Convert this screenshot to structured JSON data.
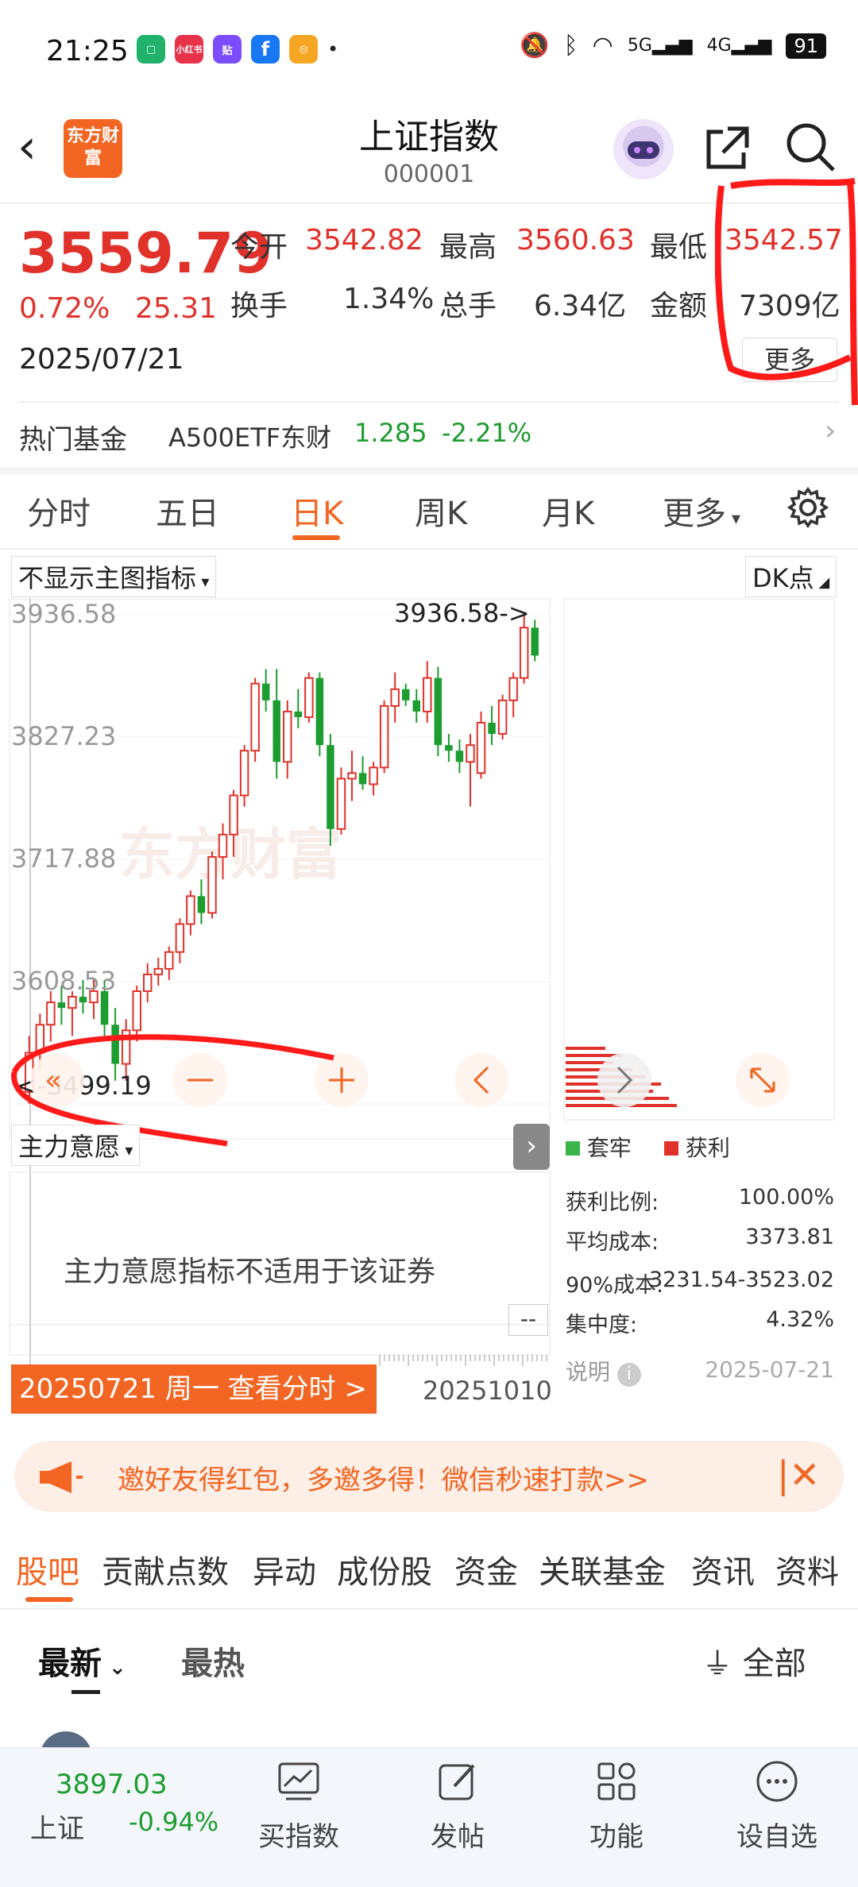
{
  "status_bar": {
    "time": "21:25",
    "app_icons": [
      "小红书",
      "贴",
      "f"
    ],
    "battery": "91"
  },
  "header": {
    "logo_text": "东方财富",
    "title": "上证指数",
    "code": "000001"
  },
  "quote": {
    "price": "3559.79",
    "change_pct": "0.72%",
    "change": "25.31",
    "date": "2025/07/21",
    "open_label": "今开",
    "open": "3542.82",
    "high_label": "最高",
    "high": "3560.63",
    "low_label": "最低",
    "low": "3542.57",
    "turnover_label": "换手",
    "turnover": "1.34%",
    "volume_label": "总手",
    "volume": "6.34亿",
    "amount_label": "金额",
    "amount": "7309亿",
    "more_label": "更多"
  },
  "hot_fund": {
    "label": "热门基金",
    "name": "A500ETF东财",
    "price": "1.285",
    "change": "-2.21%"
  },
  "kline_tabs": {
    "items": [
      "分时",
      "五日",
      "日K",
      "周K",
      "月K"
    ],
    "more": "更多",
    "active": "日K"
  },
  "chart": {
    "indicator_dropdown": "不显示主图指标",
    "dk_dropdown": "DK点",
    "watermark": "东方财富",
    "high_marker": "3936.58->",
    "low_marker": "<-3499.19",
    "sub_indicator": "主力意愿",
    "sub_message": "主力意愿指标不适用于该证券",
    "sub_value": "--",
    "cursor_date": "20250721 周一 查看分时 >",
    "end_date": "20251010"
  },
  "chart_data": {
    "type": "candlestick",
    "y_ticks": [
      "3936.58",
      "3827.23",
      "3717.88",
      "3608.53",
      "3499.19"
    ],
    "ylim": [
      3499.19,
      3936.58
    ],
    "candles": [
      {
        "o": 3510,
        "h": 3560,
        "l": 3499.19,
        "c": 3545
      },
      {
        "o": 3545,
        "h": 3580,
        "l": 3530,
        "c": 3570
      },
      {
        "o": 3570,
        "h": 3600,
        "l": 3555,
        "c": 3590
      },
      {
        "o": 3590,
        "h": 3605,
        "l": 3570,
        "c": 3585
      },
      {
        "o": 3585,
        "h": 3600,
        "l": 3560,
        "c": 3595
      },
      {
        "o": 3595,
        "h": 3610,
        "l": 3580,
        "c": 3590
      },
      {
        "o": 3590,
        "h": 3612,
        "l": 3575,
        "c": 3600
      },
      {
        "o": 3600,
        "h": 3610,
        "l": 3560,
        "c": 3570
      },
      {
        "o": 3570,
        "h": 3585,
        "l": 3520,
        "c": 3535
      },
      {
        "o": 3535,
        "h": 3575,
        "l": 3520,
        "c": 3565
      },
      {
        "o": 3565,
        "h": 3605,
        "l": 3555,
        "c": 3600
      },
      {
        "o": 3600,
        "h": 3625,
        "l": 3590,
        "c": 3615
      },
      {
        "o": 3615,
        "h": 3630,
        "l": 3605,
        "c": 3620
      },
      {
        "o": 3620,
        "h": 3640,
        "l": 3610,
        "c": 3635
      },
      {
        "o": 3635,
        "h": 3665,
        "l": 3625,
        "c": 3660
      },
      {
        "o": 3660,
        "h": 3690,
        "l": 3650,
        "c": 3685
      },
      {
        "o": 3685,
        "h": 3700,
        "l": 3660,
        "c": 3670
      },
      {
        "o": 3670,
        "h": 3725,
        "l": 3665,
        "c": 3720
      },
      {
        "o": 3720,
        "h": 3750,
        "l": 3700,
        "c": 3740
      },
      {
        "o": 3740,
        "h": 3780,
        "l": 3720,
        "c": 3775
      },
      {
        "o": 3775,
        "h": 3820,
        "l": 3765,
        "c": 3815
      },
      {
        "o": 3815,
        "h": 3880,
        "l": 3805,
        "c": 3875
      },
      {
        "o": 3875,
        "h": 3888,
        "l": 3850,
        "c": 3860
      },
      {
        "o": 3860,
        "h": 3888,
        "l": 3790,
        "c": 3805
      },
      {
        "o": 3805,
        "h": 3860,
        "l": 3790,
        "c": 3850
      },
      {
        "o": 3850,
        "h": 3870,
        "l": 3835,
        "c": 3845
      },
      {
        "o": 3845,
        "h": 3885,
        "l": 3840,
        "c": 3880
      },
      {
        "o": 3880,
        "h": 3885,
        "l": 3810,
        "c": 3820
      },
      {
        "o": 3820,
        "h": 3830,
        "l": 3730,
        "c": 3745
      },
      {
        "o": 3745,
        "h": 3800,
        "l": 3740,
        "c": 3790
      },
      {
        "o": 3790,
        "h": 3815,
        "l": 3770,
        "c": 3795
      },
      {
        "o": 3795,
        "h": 3810,
        "l": 3780,
        "c": 3785
      },
      {
        "o": 3785,
        "h": 3805,
        "l": 3775,
        "c": 3800
      },
      {
        "o": 3800,
        "h": 3860,
        "l": 3795,
        "c": 3855
      },
      {
        "o": 3855,
        "h": 3885,
        "l": 3840,
        "c": 3870
      },
      {
        "o": 3870,
        "h": 3875,
        "l": 3855,
        "c": 3860
      },
      {
        "o": 3860,
        "h": 3870,
        "l": 3840,
        "c": 3850
      },
      {
        "o": 3850,
        "h": 3895,
        "l": 3840,
        "c": 3880
      },
      {
        "o": 3880,
        "h": 3890,
        "l": 3810,
        "c": 3820
      },
      {
        "o": 3820,
        "h": 3830,
        "l": 3805,
        "c": 3815
      },
      {
        "o": 3815,
        "h": 3825,
        "l": 3795,
        "c": 3805
      },
      {
        "o": 3805,
        "h": 3830,
        "l": 3765,
        "c": 3820
      },
      {
        "o": 3795,
        "h": 3850,
        "l": 3790,
        "c": 3840
      },
      {
        "o": 3840,
        "h": 3855,
        "l": 3820,
        "c": 3830
      },
      {
        "o": 3830,
        "h": 3865,
        "l": 3825,
        "c": 3860
      },
      {
        "o": 3860,
        "h": 3885,
        "l": 3845,
        "c": 3880
      },
      {
        "o": 3880,
        "h": 3936.58,
        "l": 3875,
        "c": 3925
      },
      {
        "o": 3925,
        "h": 3932,
        "l": 3895,
        "c": 3900
      }
    ]
  },
  "chip": {
    "legend_trapped": "套牢",
    "legend_profit": "获利",
    "rows": [
      {
        "label": "获利比例:",
        "value": "100.00%"
      },
      {
        "label": "平均成本:",
        "value": "3373.81"
      },
      {
        "label": "90%成本:",
        "value": "3231.54-3523.02"
      },
      {
        "label": "集中度:",
        "value": "4.32%"
      }
    ],
    "note_label": "说明",
    "note_date": "2025-07-21",
    "colors": {
      "trapped": "#3bb54a",
      "profit": "#e0322b"
    }
  },
  "banner": {
    "text": "邀好友得红包，多邀多得！微信秒速打款>>"
  },
  "bottom_tabs": {
    "items": [
      "股吧",
      "贡献点数",
      "异动",
      "成份股",
      "资金",
      "关联基金",
      "资讯",
      "资料"
    ],
    "active": "股吧"
  },
  "sort": {
    "latest": "最新",
    "hot": "最热",
    "filter": "全部"
  },
  "bottom_nav": {
    "index_value": "3897.03",
    "index_name": "上证",
    "index_change": "-0.94%",
    "items": [
      "买指数",
      "发帖",
      "功能",
      "设自选"
    ]
  }
}
